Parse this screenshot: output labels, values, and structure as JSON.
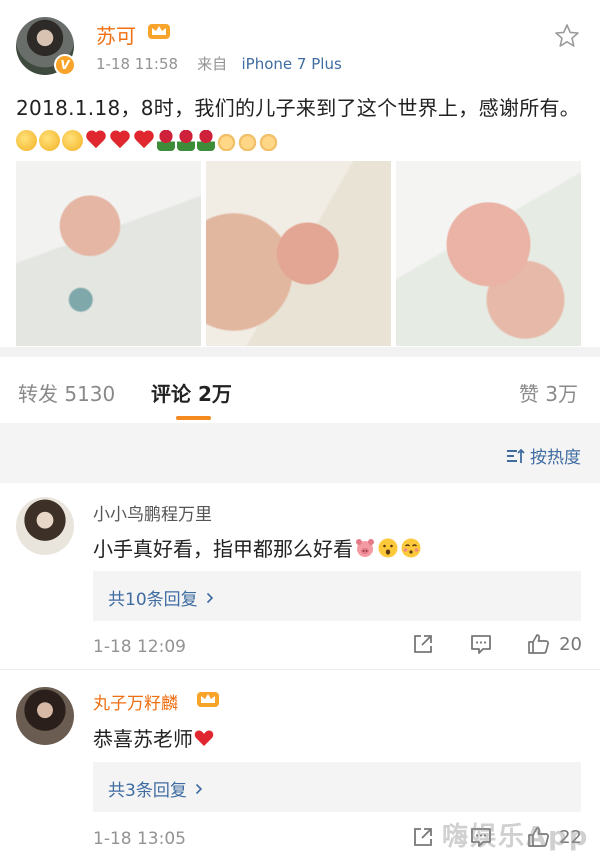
{
  "post": {
    "author": "苏可",
    "time": "1-18 11:58",
    "source_prefix": "来自",
    "source": "iPhone 7 Plus",
    "text": "2018.1.18，8时，我们的儿子来到了这个世界上，感谢所有。",
    "emojis": [
      "blowing-kiss",
      "blowing-kiss",
      "blowing-kiss",
      "heart",
      "heart",
      "heart",
      "rose",
      "rose",
      "rose",
      "victory-hand",
      "victory-hand",
      "victory-hand"
    ],
    "photos": [
      "baby-foot-photo",
      "baby-fist-photo",
      "baby-hand-holding-finger-photo"
    ]
  },
  "tabs": {
    "repost": "转发 5130",
    "comments": "评论 2万",
    "likes": "赞 3万"
  },
  "sort": {
    "label": "按热度"
  },
  "comments": [
    {
      "user": "小小鸟鹏程万里",
      "text": "小手真好看，指甲都那么好看",
      "emojis": [
        "pig-face",
        "astonished",
        "kissing-closed-eyes"
      ],
      "replies": "共10条回复",
      "time": "1-18 12:09",
      "likes": "20"
    },
    {
      "user": "丸子万籽麟",
      "text": "恭喜苏老师",
      "emojis": [
        "heart"
      ],
      "replies": "共3条回复",
      "time": "1-18 13:05",
      "likes": "22"
    }
  ],
  "watermark": "嗨娱乐App",
  "colors": {
    "accent_orange": "#f06f13",
    "link_blue": "#3f6ca1",
    "tab_underline": "#f48a20",
    "muted_gray": "#939393"
  }
}
